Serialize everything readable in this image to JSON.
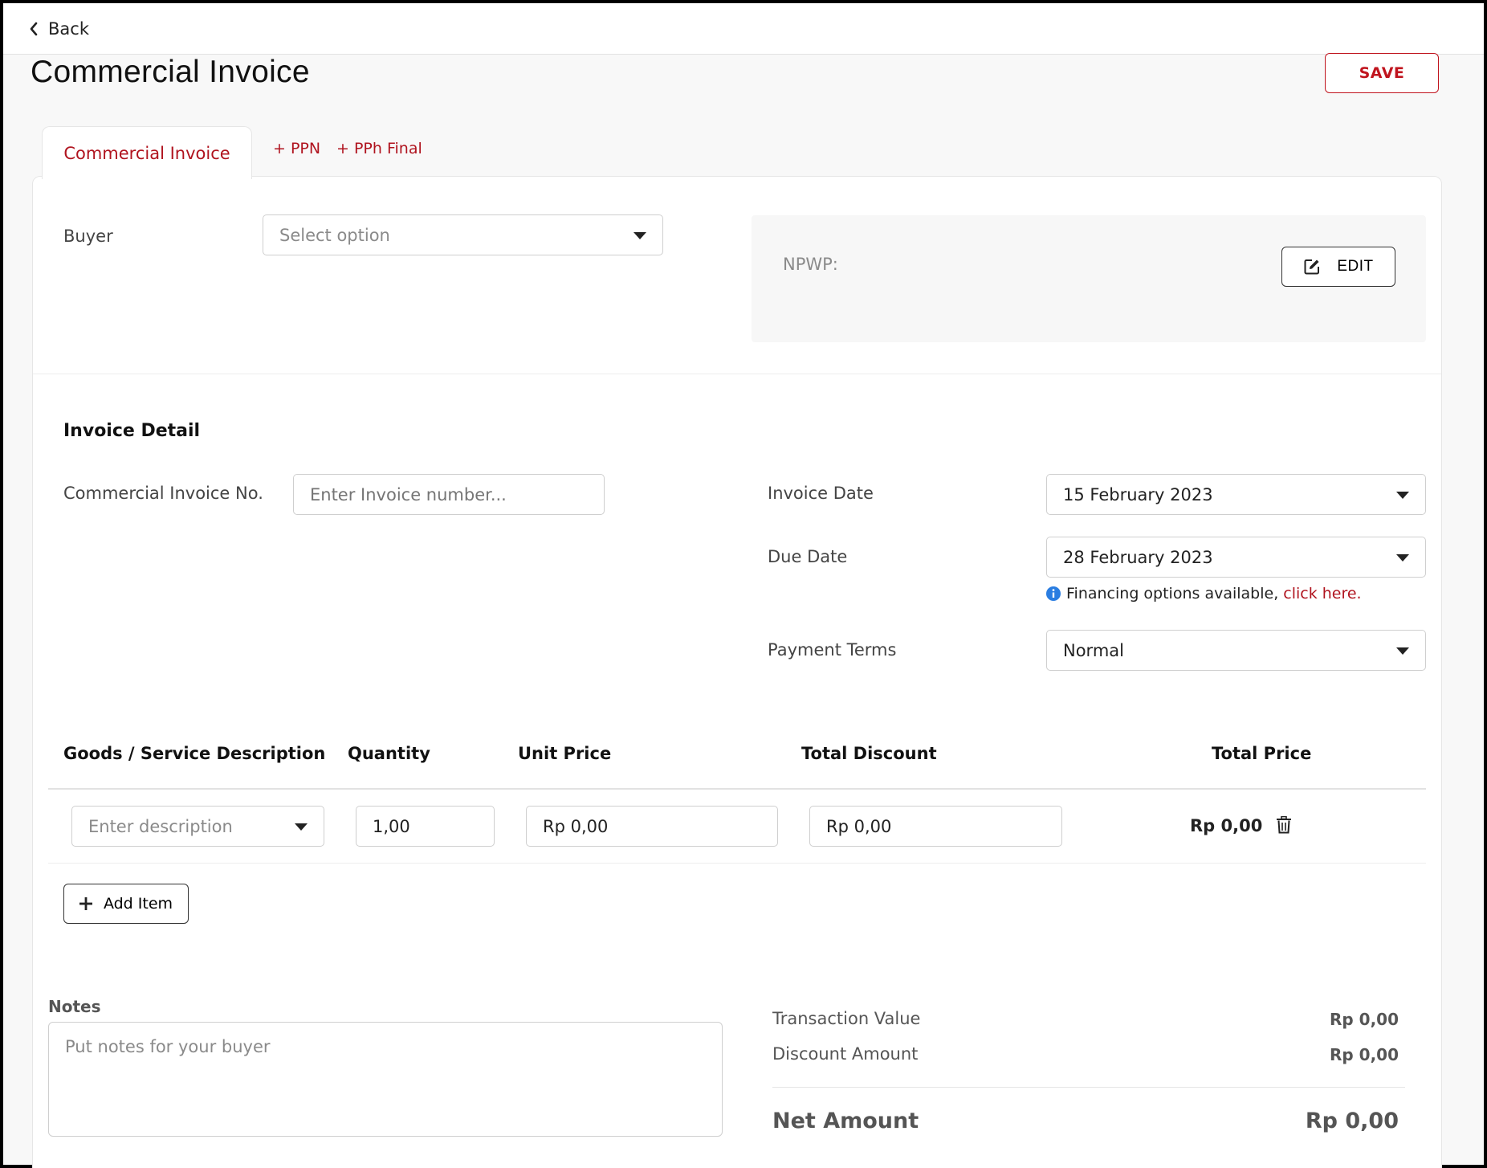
{
  "colors": {
    "accent": "#b0141f",
    "border": "#cfcfcf",
    "info": "#2a7de1"
  },
  "topbar": {
    "back_label": "Back",
    "back_icon": "chevron-left-icon"
  },
  "page": {
    "title": "Commercial Invoice",
    "save_label": "SAVE"
  },
  "tabs": [
    {
      "label": "Commercial Invoice",
      "active": true
    },
    {
      "label": "+ PPN",
      "active": false
    },
    {
      "label": "+ PPh Final",
      "active": false
    }
  ],
  "buyer": {
    "label": "Buyer",
    "placeholder": "Select option",
    "npwp_label": "NPWP:",
    "edit_label": "EDIT"
  },
  "invoice_detail": {
    "title": "Invoice Detail",
    "invoice_no_label": "Commercial Invoice No.",
    "invoice_no_placeholder": "Enter Invoice number...",
    "invoice_date_label": "Invoice Date",
    "invoice_date_value": "15 February 2023",
    "due_date_label": "Due Date",
    "due_date_value": "28 February 2023",
    "financing_text": "Financing options available,",
    "financing_link": "click here.",
    "payment_terms_label": "Payment Terms",
    "payment_terms_value": "Normal"
  },
  "items_table": {
    "headers": [
      "Goods / Service Description",
      "Quantity",
      "Unit Price",
      "Total Discount",
      "Total Price"
    ],
    "rows": [
      {
        "description_placeholder": "Enter description",
        "quantity": "1,00",
        "unit_price": "Rp 0,00",
        "total_discount": "Rp 0,00",
        "total_price": "Rp 0,00"
      }
    ],
    "add_item_label": "Add Item"
  },
  "notes": {
    "label": "Notes",
    "placeholder": "Put notes for your buyer"
  },
  "summary": {
    "transaction_value_label": "Transaction Value",
    "transaction_value": "Rp 0,00",
    "discount_amount_label": "Discount Amount",
    "discount_amount": "Rp 0,00",
    "net_amount_label": "Net Amount",
    "net_amount": "Rp 0,00"
  }
}
